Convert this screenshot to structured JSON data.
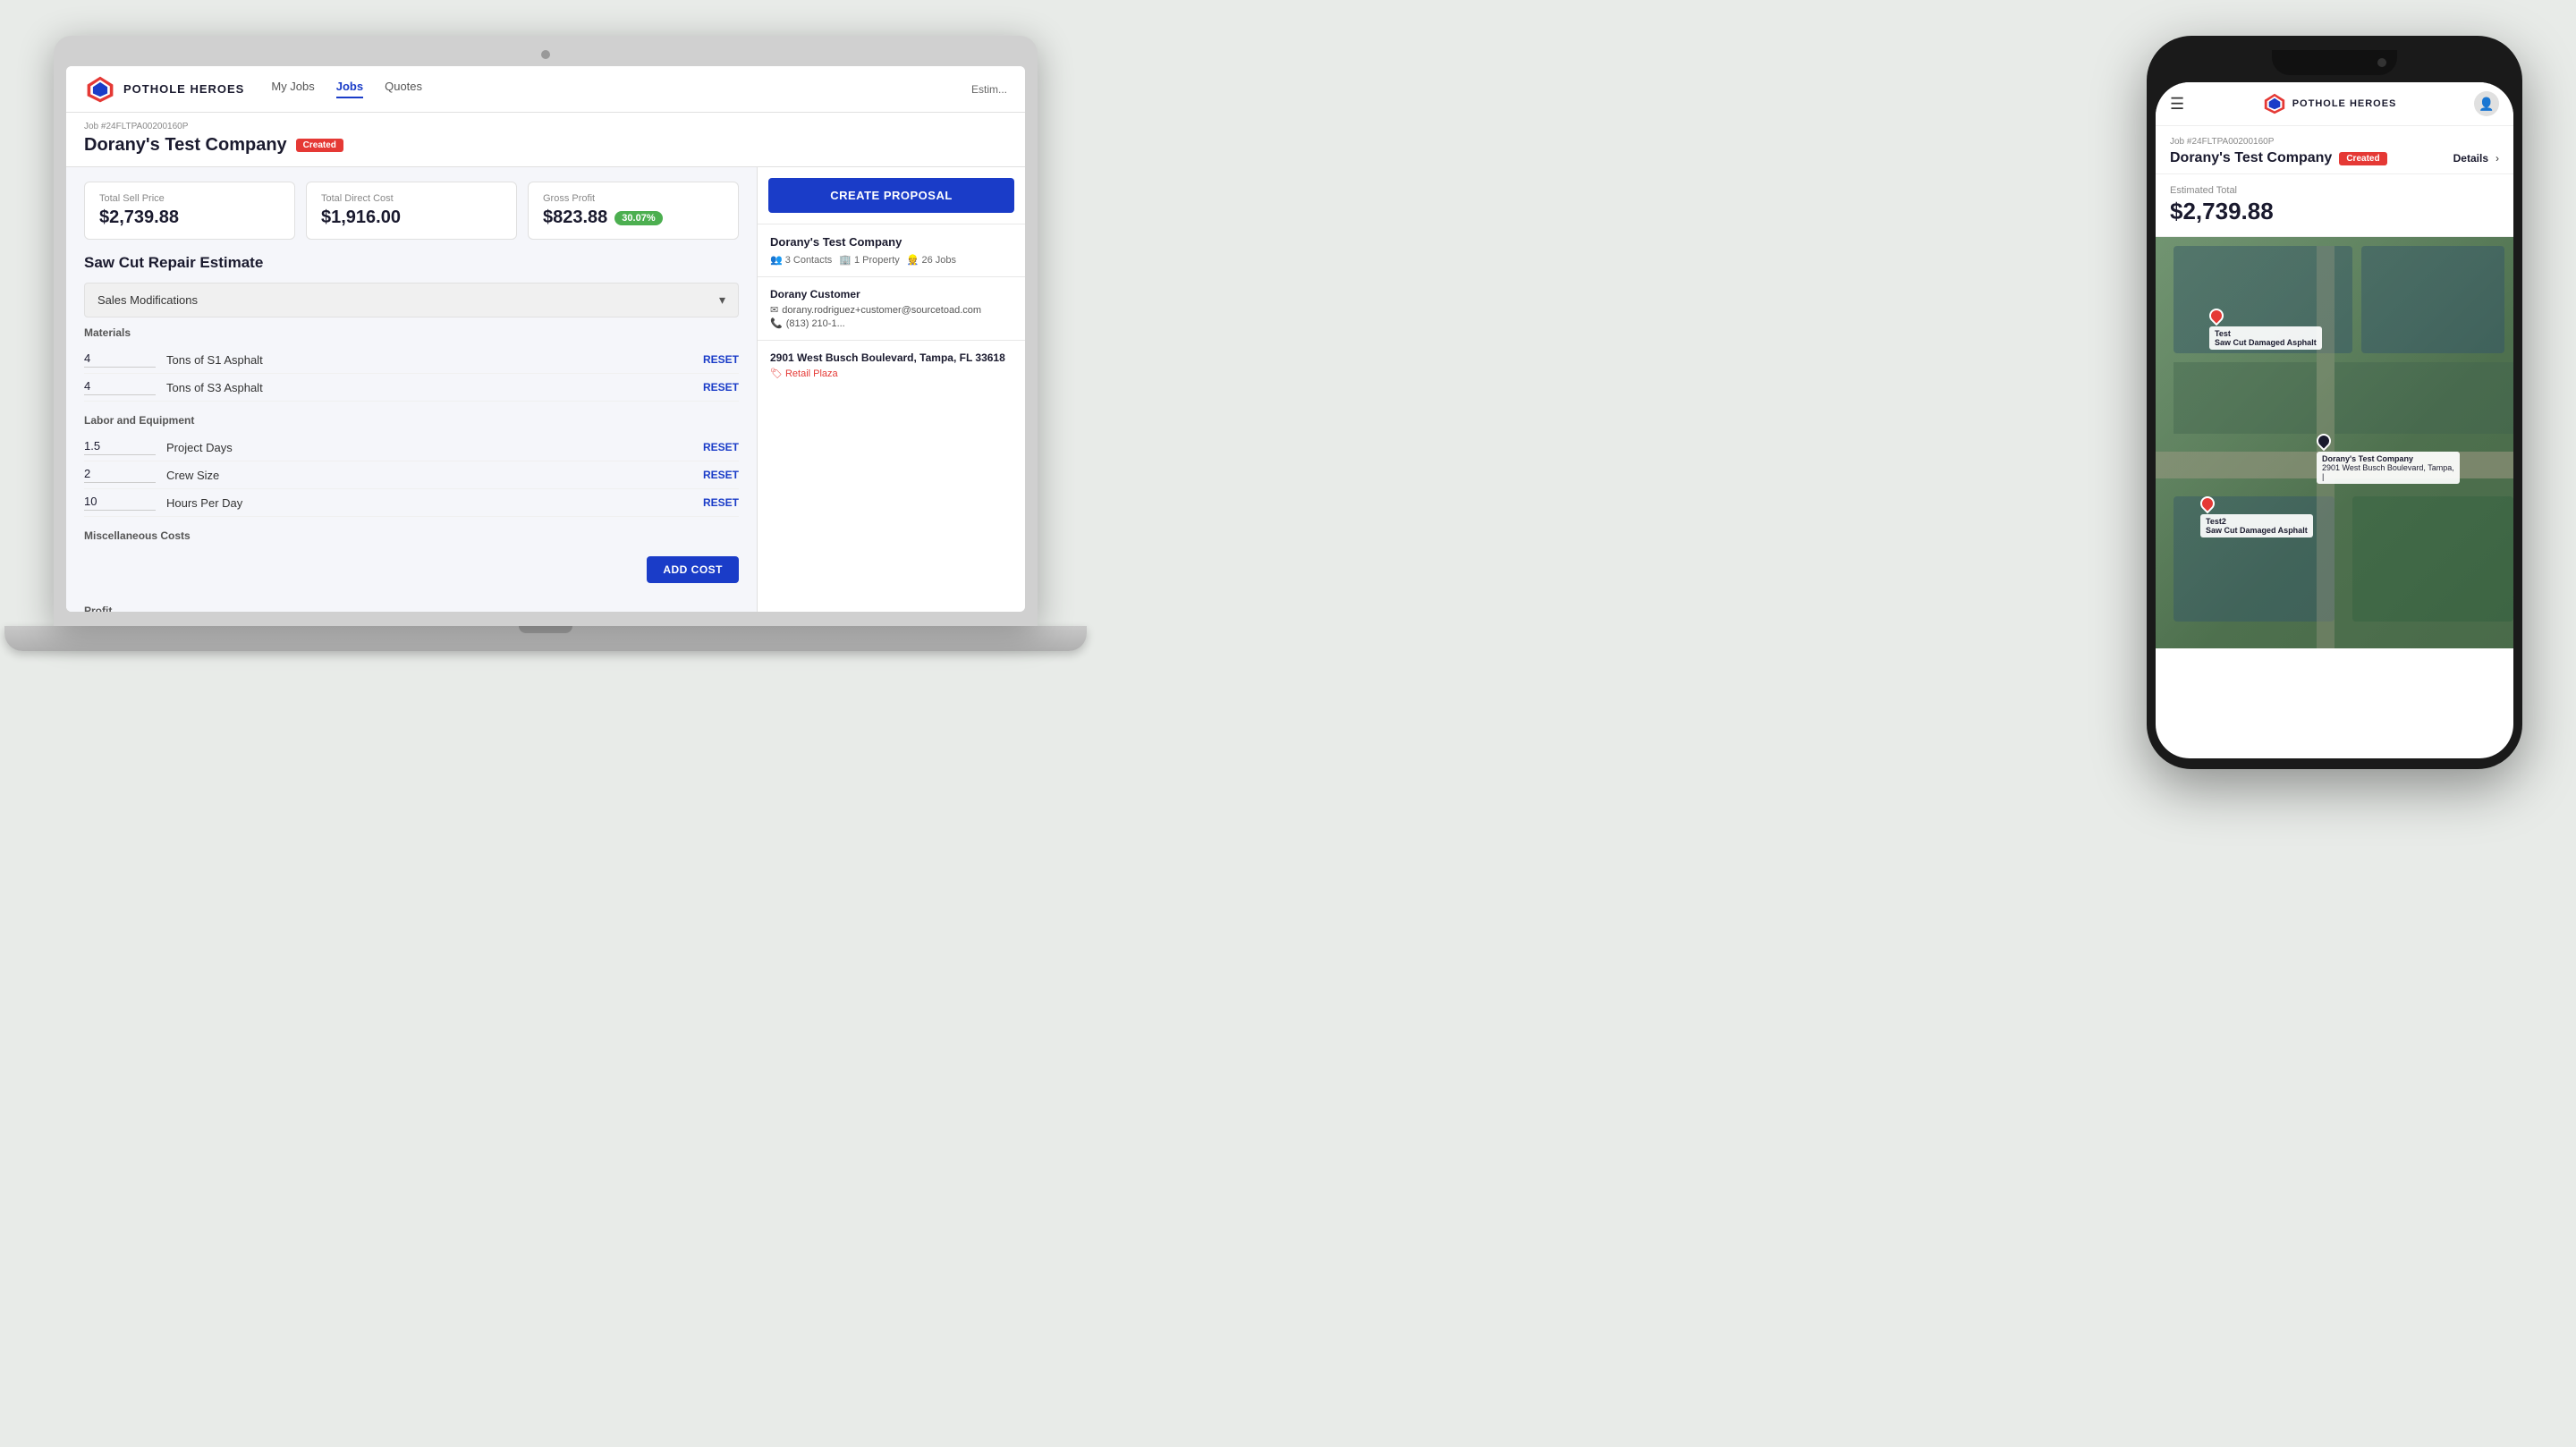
{
  "app": {
    "logo_text": "POTHOLE HEROES",
    "nav": {
      "tabs": [
        {
          "label": "My Jobs",
          "active": false
        },
        {
          "label": "Jobs",
          "active": true
        },
        {
          "label": "Quotes",
          "active": false
        }
      ]
    }
  },
  "job": {
    "id": "Job #24FLTPA00200160P",
    "company": "Dorany's Test Company",
    "status": "Created",
    "header_right": "Estim...",
    "stats": {
      "sell_price_label": "Total Sell Price",
      "sell_price_value": "$2,739.88",
      "direct_cost_label": "Total Direct Cost",
      "direct_cost_value": "$1,916.00",
      "gross_profit_label": "Gross Profit",
      "gross_profit_value": "$823.88",
      "gross_profit_pct": "30.07%"
    },
    "estimate_title": "Saw Cut Repair Estimate",
    "sales_modifications_label": "Sales Modifications",
    "materials_label": "Materials",
    "items_materials": [
      {
        "value": "4",
        "description": "Tons of S1 Asphalt"
      },
      {
        "value": "4",
        "description": "Tons of S3 Asphalt"
      }
    ],
    "labor_equipment_label": "Labor and Equipment",
    "items_labor": [
      {
        "value": "1.5",
        "description": "Project Days"
      },
      {
        "value": "2",
        "description": "Crew Size"
      },
      {
        "value": "10",
        "description": "Hours Per Day"
      }
    ],
    "misc_costs_label": "Miscellaneous Costs",
    "add_cost_btn": "ADD COST",
    "profit_label": "Profit",
    "reset_label": "RESET",
    "create_proposal_btn": "CREATE PROPOSAL",
    "sidebar": {
      "company_name": "Dorany's Test Company",
      "contacts": "3 Contacts",
      "property": "1 Property",
      "jobs": "26 Jobs",
      "contact_name": "Dorany Customer",
      "email": "dorany.rodriguez+customer@sourcetoad.com",
      "phone": "(813) 210-1...",
      "address": "2901 West Busch Boulevard, Tampa, FL 33618",
      "address_type": "Retail Plaza"
    }
  },
  "phone": {
    "job_id": "Job #24FLTPA00200160P",
    "company": "Dorany's Test Company",
    "status": "Created",
    "logo_text": "POTHOLE HEROES",
    "details_btn": "Details",
    "estimated_total_label": "Estimated Total",
    "estimated_total_value": "$2,739.88",
    "map_pin1_label": "Test\nSaw Cut Damaged Asphalt",
    "map_pin2_label": "Test2\nSaw Cut Damaged Asphalt",
    "map_pin3_label": "Dorany's Test Company\n2901 West Busch Boulevard, Tampa, |"
  },
  "icons": {
    "menu": "☰",
    "user": "👤",
    "email": "✉",
    "phone": "📞",
    "location": "📍",
    "tag": "🏷",
    "contacts": "👥",
    "property": "🏢",
    "jobs": "👷",
    "chevron_down": "▾",
    "chevron_right": "›"
  }
}
